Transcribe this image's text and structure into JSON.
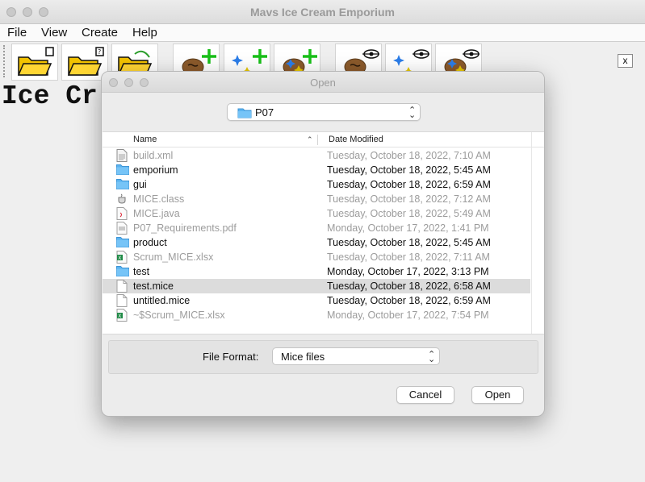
{
  "window": {
    "title": "Mavs Ice Cream Emporium"
  },
  "menu": [
    "File",
    "View",
    "Create",
    "Help"
  ],
  "toolbar": {
    "close_label": "x"
  },
  "main": {
    "heading_partial": "Ice Cr"
  },
  "dialog": {
    "title": "Open",
    "location": "P07",
    "columns": {
      "name": "Name",
      "date": "Date Modified"
    },
    "files": [
      {
        "name": "build.xml",
        "date": "Tuesday, October 18, 2022, 7:10 AM",
        "icon": "xml-file-icon",
        "dim": true
      },
      {
        "name": "emporium",
        "date": "Tuesday, October 18, 2022, 5:45 AM",
        "icon": "folder-icon",
        "dim": false
      },
      {
        "name": "gui",
        "date": "Tuesday, October 18, 2022, 6:59 AM",
        "icon": "folder-icon",
        "dim": false
      },
      {
        "name": "MICE.class",
        "date": "Tuesday, October 18, 2022, 7:12 AM",
        "icon": "java-class-icon",
        "dim": true
      },
      {
        "name": "MICE.java",
        "date": "Tuesday, October 18, 2022, 5:49 AM",
        "icon": "java-file-icon",
        "dim": true
      },
      {
        "name": "P07_Requirements.pdf",
        "date": "Monday, October 17, 2022, 1:41 PM",
        "icon": "pdf-file-icon",
        "dim": true
      },
      {
        "name": "product",
        "date": "Tuesday, October 18, 2022, 5:45 AM",
        "icon": "folder-icon",
        "dim": false
      },
      {
        "name": "Scrum_MICE.xlsx",
        "date": "Tuesday, October 18, 2022, 7:11 AM",
        "icon": "excel-file-icon",
        "dim": true
      },
      {
        "name": "test",
        "date": "Monday, October 17, 2022, 3:13 PM",
        "icon": "folder-icon",
        "dim": false
      },
      {
        "name": "test.mice",
        "date": "Tuesday, October 18, 2022, 6:58 AM",
        "icon": "document-icon",
        "dim": false,
        "selected": true
      },
      {
        "name": "untitled.mice",
        "date": "Tuesday, October 18, 2022, 6:59 AM",
        "icon": "document-icon",
        "dim": false
      },
      {
        "name": "~$Scrum_MICE.xlsx",
        "date": "Monday, October 17, 2022, 7:54 PM",
        "icon": "excel-file-icon",
        "dim": true
      }
    ],
    "format_label": "File Format:",
    "format_value": "Mice files",
    "cancel_label": "Cancel",
    "open_label": "Open"
  }
}
